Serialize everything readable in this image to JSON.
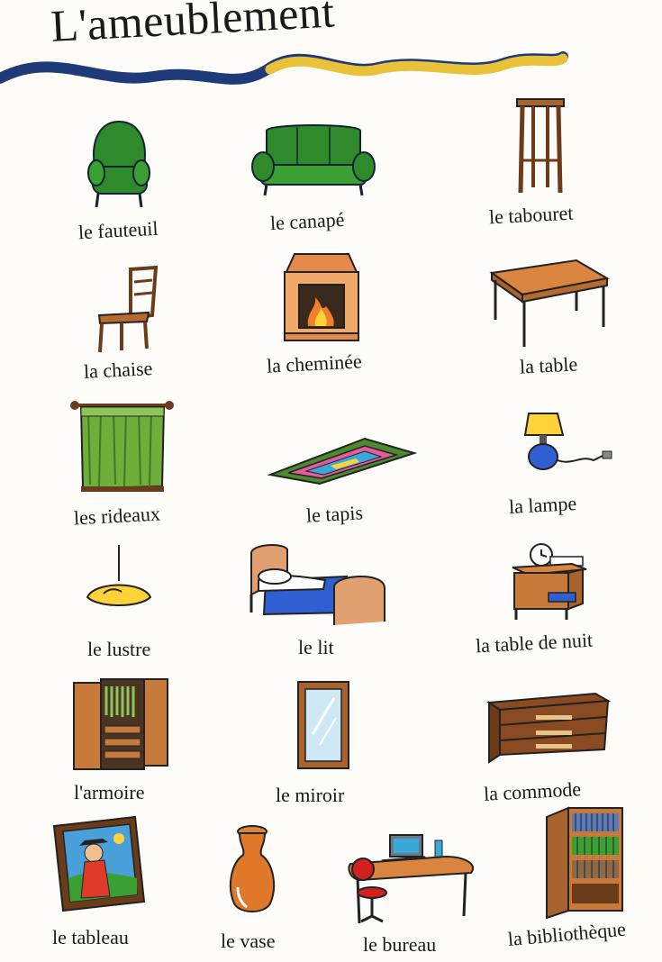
{
  "title": "L'ameublement",
  "items": [
    {
      "icon": "armchair-icon",
      "label": "le fauteuil"
    },
    {
      "icon": "sofa-icon",
      "label": "le canapé"
    },
    {
      "icon": "stool-icon",
      "label": "le tabouret"
    },
    {
      "icon": "chair-icon",
      "label": "la chaise"
    },
    {
      "icon": "fireplace-icon",
      "label": "la cheminée"
    },
    {
      "icon": "table-icon",
      "label": "la table"
    },
    {
      "icon": "curtains-icon",
      "label": "les rideaux"
    },
    {
      "icon": "rug-icon",
      "label": "le tapis"
    },
    {
      "icon": "lamp-icon",
      "label": "la lampe"
    },
    {
      "icon": "chandelier-icon",
      "label": "le lustre"
    },
    {
      "icon": "bed-icon",
      "label": "le lit"
    },
    {
      "icon": "nightstand-icon",
      "label": "la table de nuit"
    },
    {
      "icon": "wardrobe-icon",
      "label": "l'armoire"
    },
    {
      "icon": "mirror-icon",
      "label": "le miroir"
    },
    {
      "icon": "dresser-icon",
      "label": "la commode"
    },
    {
      "icon": "painting-icon",
      "label": "le tableau"
    },
    {
      "icon": "vase-icon",
      "label": "le vase"
    },
    {
      "icon": "desk-icon",
      "label": "le bureau"
    },
    {
      "icon": "bookcase-icon",
      "label": "la bibliothèque"
    }
  ],
  "colors": {
    "green": "#2e8a2a",
    "wood": "#c77a3a",
    "blue": "#2f5fd0",
    "yellow": "#e9c23a",
    "navy": "#1f3a78"
  }
}
